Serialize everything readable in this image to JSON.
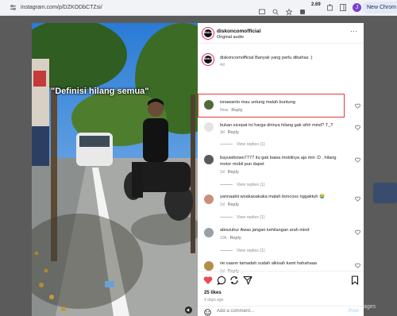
{
  "browser": {
    "url": "instagram.com/p/DZKODbCTZsi/",
    "download_badge": "2.69",
    "profile_initial": "J",
    "new_chrome_label": "New Chrom"
  },
  "backdrop": {
    "side_text": "ages"
  },
  "post": {
    "video_caption": "\"Definisi hilang semua\"",
    "author": {
      "username": "diskoncomofficial",
      "subtitle": "Original audio",
      "avatar_text": "disk:on"
    },
    "caption": {
      "username": "diskoncomofficial",
      "text": "Banyak yang perlu dibahas :)",
      "age": "4d"
    },
    "comments": [
      {
        "user": "isnawanto",
        "text": "mau untung malah buntung",
        "age": "Now",
        "reply": "Reply",
        "view_replies": "",
        "avatar_color": "#4f6b3a"
      },
      {
        "user": "bukan.sicepat",
        "text": "ini harga dirinya hilang gak sihh mind? T_T",
        "age": "3d",
        "reply": "Reply",
        "view_replies": "View replies (1)",
        "avatar_color": "#d9d9d9"
      },
      {
        "user": "bayuwibowo7777",
        "text": "itu gak bawa mobilnya aja min :D , hilang motor mobil pun dapet",
        "age": "1d",
        "reply": "Reply",
        "view_replies": "View replies (1)",
        "avatar_color": "#5a5a5a"
      },
      {
        "user": "yannaabii",
        "text": "woakaoakaka malah boncoss nggaktuh 😭",
        "age": "1d",
        "reply": "Reply",
        "view_replies": "View replies (1)",
        "avatar_color": "#c98f7a"
      },
      {
        "user": "abiszuhur",
        "text": "Awas jangan kehilangan arah mind",
        "age": "19h",
        "reply": "Reply",
        "view_replies": "View replies (1)",
        "avatar_color": "#9aa0a8"
      },
      {
        "user": "rie.vaann",
        "text": "tamadah sudah alkisah kami hahahaaa",
        "age": "1d",
        "reply": "Reply",
        "view_replies": "",
        "avatar_color": "#b48d4c"
      }
    ],
    "likes": "25 likes",
    "posted": "4 days ago",
    "add_comment_placeholder": "Add a comment...",
    "post_label": "Post"
  },
  "colors": {
    "like_red": "#ed4956",
    "highlight_red": "#e53935"
  }
}
